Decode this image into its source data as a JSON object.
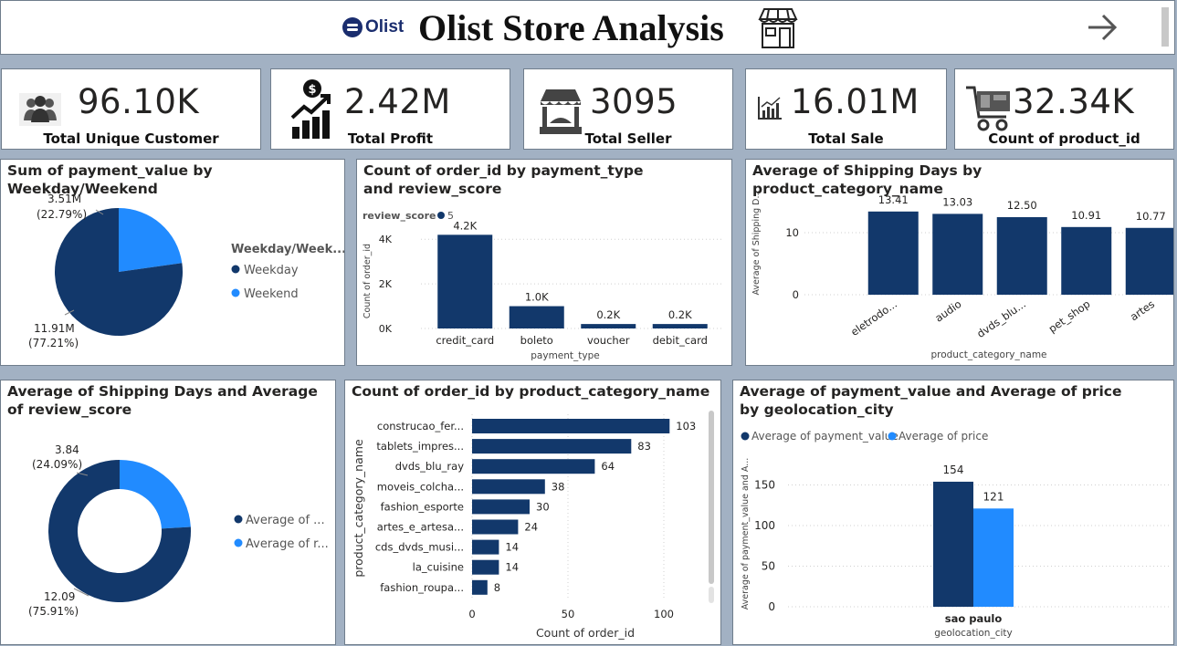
{
  "header": {
    "logo_text": "Olist",
    "title": "Olist Store Analysis"
  },
  "kpis": [
    {
      "value": "96.10K",
      "label": "Total Unique Customer",
      "icon": "people-icon"
    },
    {
      "value": "2.42M",
      "label": "Total Profit",
      "icon": "profit-growth-icon"
    },
    {
      "value": "3095",
      "label": "Total Seller",
      "icon": "store-front-icon"
    },
    {
      "value": "16.01M",
      "label": "Total Sale",
      "icon": "bar-chart-icon"
    },
    {
      "value": "32.34K",
      "label": "Count of product_id",
      "icon": "cart-icon"
    }
  ],
  "colors": {
    "dark": "#12386b",
    "light": "#218bff",
    "background": "#a2b1c3"
  },
  "chart_data": [
    {
      "id": "weekday",
      "type": "pie",
      "title": "Sum of payment_value by Weekday/Weekend",
      "legend_title": "Weekday/Week...",
      "legend_labels": [
        "Weekday",
        "Weekend"
      ],
      "categories": [
        "Weekday",
        "Weekend"
      ],
      "values": [
        11.91,
        3.51
      ],
      "data_labels": [
        "11.91M",
        "3.51M"
      ],
      "percent_labels": [
        "(77.21%)",
        "(22.79%)"
      ],
      "percents": [
        77.21,
        22.79
      ]
    },
    {
      "id": "payment",
      "type": "bar",
      "title": "Count of order_id by payment_type and review_score",
      "legend_title": "review_score",
      "legend_item": "5",
      "categories": [
        "credit_card",
        "boleto",
        "voucher",
        "debit_card"
      ],
      "values": [
        4200,
        1000,
        200,
        200
      ],
      "data_labels": [
        "4.2K",
        "1.0K",
        "0.2K",
        "0.2K"
      ],
      "xlabel": "payment_type",
      "ylabel": "Count of order_id",
      "yticks": [
        "0K",
        "2K",
        "4K"
      ],
      "ylim": [
        0,
        4500
      ]
    },
    {
      "id": "shipping",
      "type": "bar",
      "title": "Average of Shipping Days by product_category_name",
      "categories": [
        "eletrodo...",
        "audio",
        "dvds_blu...",
        "pet_shop",
        "artes"
      ],
      "values": [
        13.41,
        13.03,
        12.5,
        10.91,
        10.77
      ],
      "data_labels": [
        "13.41",
        "13.03",
        "12.50",
        "10.91",
        "10.77"
      ],
      "xlabel": "product_category_name",
      "ylabel": "Average of Shipping D...",
      "yticks": [
        "0",
        "10"
      ],
      "ylim": [
        0,
        15
      ]
    },
    {
      "id": "review",
      "type": "pie",
      "title": "Average of Shipping Days and Average of review_score",
      "legend_labels": [
        "Average of ...",
        "Average of r..."
      ],
      "categories": [
        "Average of Shipping Days",
        "Average of review_score"
      ],
      "values": [
        12.09,
        3.84
      ],
      "data_labels": [
        "12.09",
        "3.84"
      ],
      "percent_labels": [
        "(75.91%)",
        "(24.09%)"
      ],
      "percents": [
        75.91,
        24.09
      ]
    },
    {
      "id": "category",
      "type": "bar",
      "orientation": "horizontal",
      "title": "Count of order_id by product_category_name",
      "categories": [
        "construcao_fer...",
        "tablets_impres...",
        "dvds_blu_ray",
        "moveis_colcha...",
        "fashion_esporte",
        "artes_e_artesa...",
        "cds_dvds_musi...",
        "la_cuisine",
        "fashion_roupa..."
      ],
      "values": [
        103,
        83,
        64,
        38,
        30,
        24,
        14,
        14,
        8
      ],
      "data_labels": [
        "103",
        "83",
        "64",
        "38",
        "30",
        "24",
        "14",
        "14",
        "8"
      ],
      "xlabel": "Count of order_id",
      "ylabel": "product_category_name",
      "xticks": [
        "0",
        "50",
        "100"
      ],
      "xlim": [
        0,
        107
      ]
    },
    {
      "id": "city",
      "type": "bar",
      "title": "Average of payment_value and Average of price by geolocation_city",
      "categories": [
        "sao paulo"
      ],
      "series": [
        {
          "name": "Average of payment_value",
          "values": [
            154
          ]
        },
        {
          "name": "Average of price",
          "values": [
            121
          ]
        }
      ],
      "data_labels": [
        "154",
        "121"
      ],
      "xlabel": "geolocation_city",
      "ylabel": "Average of payment_value and A...",
      "yticks": [
        "0",
        "50",
        "100",
        "150"
      ],
      "ylim": [
        0,
        165
      ]
    }
  ]
}
